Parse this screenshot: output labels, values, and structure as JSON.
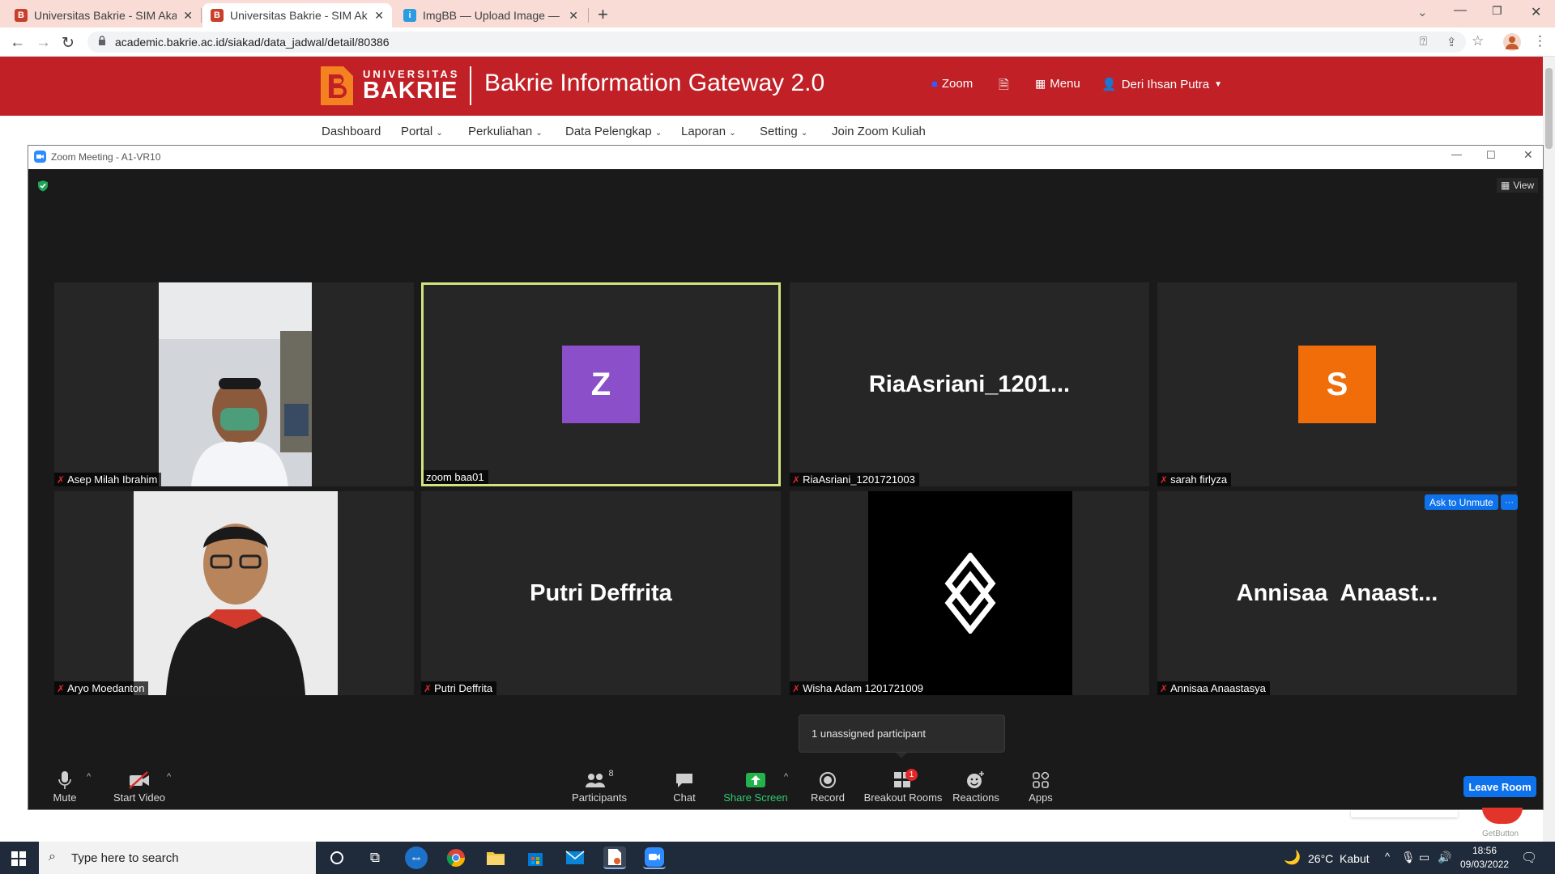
{
  "browser": {
    "tabs": [
      {
        "title": "Universitas Bakrie - SIM Akadem",
        "favicon": "bakrie-icon",
        "active": false
      },
      {
        "title": "Universitas Bakrie - SIM Akadem",
        "favicon": "bakrie-icon",
        "active": true
      },
      {
        "title": "ImgBB — Upload Image — Free",
        "favicon": "imgbb-icon",
        "active": false
      }
    ],
    "url": "academic.bakrie.ac.id/siakad/data_jadwal/detail/80386"
  },
  "site": {
    "logo_top": "UNIVERSITAS",
    "logo_bottom": "BAKRIE",
    "title": "Bakrie Information Gateway 2.0",
    "zoom_link": "Zoom",
    "menu_link": "Menu",
    "user": "Deri Ihsan Putra",
    "nav": [
      "Dashboard",
      "Portal",
      "Perkuliahan",
      "Data Pelengkap",
      "Laporan",
      "Setting",
      "Join Zoom Kuliah"
    ]
  },
  "zoom": {
    "window_title": "Zoom Meeting - A1-VR10",
    "view_label": "View",
    "participants": [
      {
        "name": "Asep Milah Ibrahim",
        "type": "video"
      },
      {
        "name": "zoom baa01",
        "type": "avatar",
        "initial": "Z",
        "color": "#8a4fc9",
        "speaking": true
      },
      {
        "name": "RiaAsriani_1201721003",
        "type": "text",
        "display": "RiaAsriani_1201..."
      },
      {
        "name": "sarah firlyza",
        "type": "avatar",
        "initial": "S",
        "color": "#f06d0a"
      },
      {
        "name": "Aryo Moedanton",
        "type": "video"
      },
      {
        "name": "Putri Deffrita",
        "type": "text",
        "display": "Putri Deffrita"
      },
      {
        "name": "Wisha Adam 1201721009",
        "type": "logo"
      },
      {
        "name": "Annisaa Anaastasya",
        "type": "text",
        "display": "Annisaa  Anaast..."
      }
    ],
    "ask_to_unmute": "Ask to Unmute",
    "more_label": "···",
    "tooltip": "1 unassigned participant",
    "controls": {
      "mute": "Mute",
      "start_video": "Start Video",
      "participants": "Participants",
      "participants_count": "8",
      "chat": "Chat",
      "share_screen": "Share Screen",
      "record": "Record",
      "breakout_rooms": "Breakout Rooms",
      "breakout_badge": "1",
      "reactions": "Reactions",
      "apps": "Apps",
      "leave": "Leave Room"
    }
  },
  "getbutton_label": "GetButton",
  "taskbar": {
    "search_placeholder": "Type here to search",
    "weather": "26°C  Kabut",
    "time": "18:56",
    "date": "09/03/2022"
  }
}
